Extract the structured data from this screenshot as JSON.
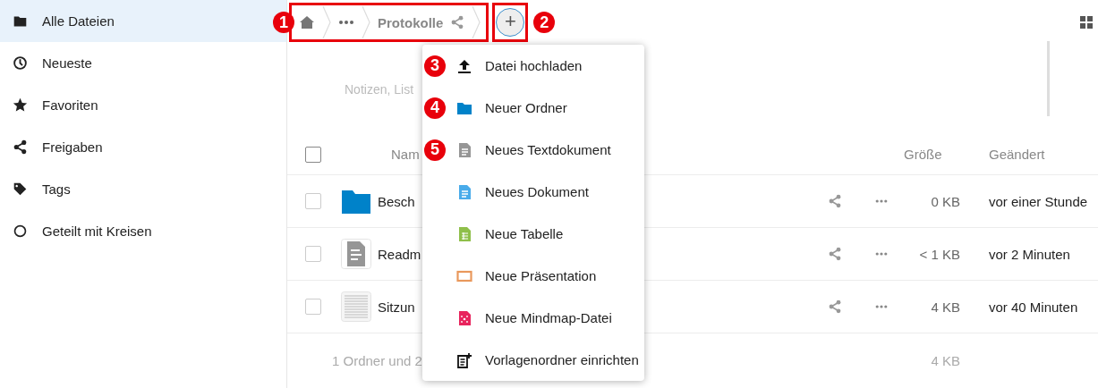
{
  "sidebar": {
    "items": [
      {
        "label": "Alle Dateien",
        "selected": true
      },
      {
        "label": "Neueste",
        "selected": false
      },
      {
        "label": "Favoriten",
        "selected": false
      },
      {
        "label": "Freigaben",
        "selected": false
      },
      {
        "label": "Tags",
        "selected": false
      },
      {
        "label": "Geteilt mit Kreisen",
        "selected": false
      }
    ]
  },
  "breadcrumbs": {
    "marker": "1",
    "items": [
      {
        "kind": "home"
      },
      {
        "kind": "more"
      },
      {
        "kind": "folder",
        "label": "Protokolle",
        "shared": true
      }
    ]
  },
  "new_button": {
    "label": "+",
    "marker": "2"
  },
  "description": {
    "placeholder": "Notizen, List"
  },
  "table": {
    "columns": [
      "Nam",
      "Größe",
      "Geändert"
    ],
    "all_selected": false,
    "rows": [
      {
        "kind": "folder",
        "name": "Besch",
        "size": "0 KB",
        "modified": "vor einer Stunde",
        "selected": false
      },
      {
        "kind": "text",
        "name": "Readm",
        "size": "< 1 KB",
        "modified": "vor 2 Minuten",
        "selected": false
      },
      {
        "kind": "document",
        "name": "Sitzun",
        "size": "4 KB",
        "modified": "vor 40 Minuten",
        "selected": false
      }
    ],
    "summary": {
      "label": "1 Ordner und 2",
      "size": "4 KB"
    }
  },
  "menu": {
    "items": [
      {
        "label": "Datei hochladen",
        "marker": "3"
      },
      {
        "label": "Neuer Ordner",
        "marker": "4"
      },
      {
        "label": "Neues Textdokument",
        "marker": "5"
      },
      {
        "label": "Neues Dokument"
      },
      {
        "label": "Neue Tabelle"
      },
      {
        "label": "Neue Präsentation"
      },
      {
        "label": "Neue Mindmap-Datei"
      },
      {
        "label": "Vorlagenordner einrichten"
      }
    ]
  }
}
